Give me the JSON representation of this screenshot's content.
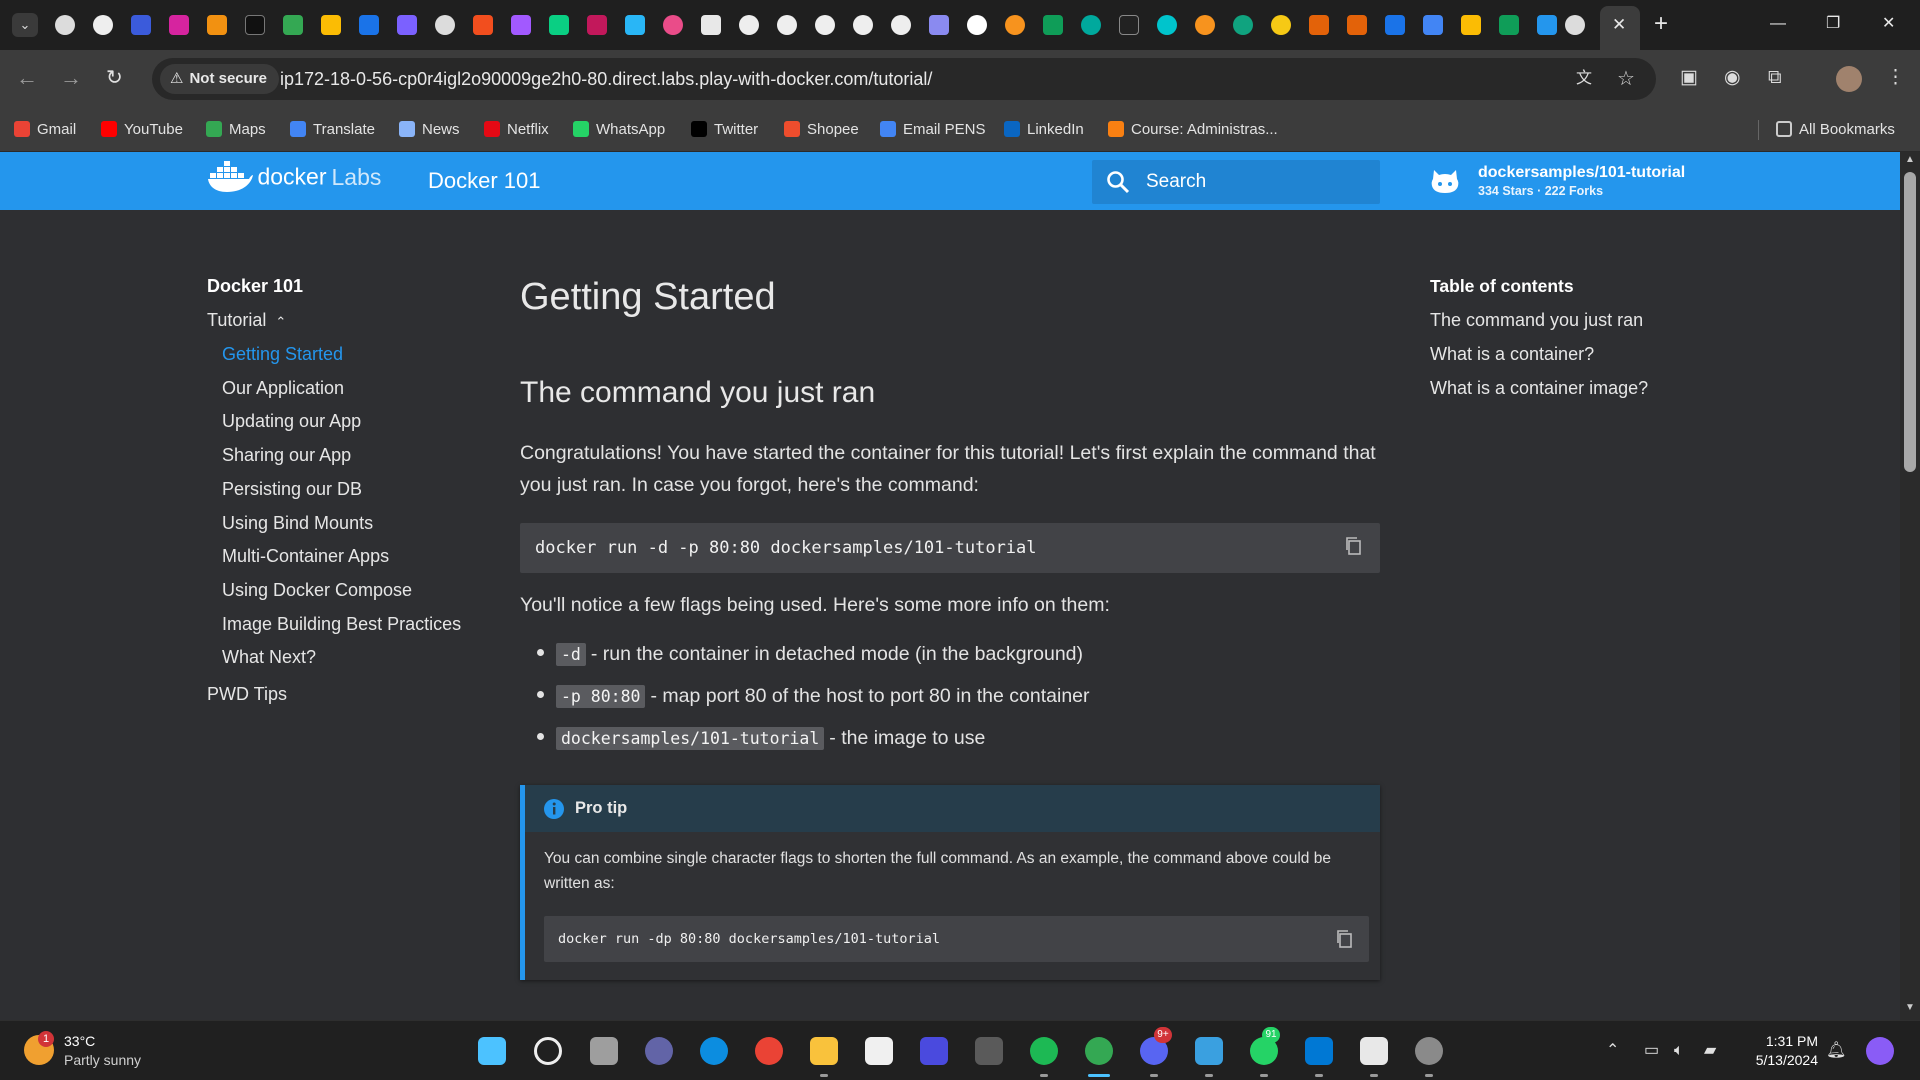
{
  "browser": {
    "tab_close": "✕",
    "new_tab": "+",
    "address": {
      "security_label": "Not secure",
      "url": "ip172-18-0-56-cp0r4igl2o90009ge2h0-80.direct.labs.play-with-docker.com/tutorial/"
    },
    "bookmarks": [
      {
        "label": "Gmail",
        "icon": "gmail-icon",
        "color": "#ea4335"
      },
      {
        "label": "YouTube",
        "icon": "youtube-icon",
        "color": "#ff0000"
      },
      {
        "label": "Maps",
        "icon": "maps-icon",
        "color": "#34a853"
      },
      {
        "label": "Translate",
        "icon": "translate-icon",
        "color": "#4285f4"
      },
      {
        "label": "News",
        "icon": "news-icon",
        "color": "#8ab4f8"
      },
      {
        "label": "Netflix",
        "icon": "netflix-icon",
        "color": "#e50914"
      },
      {
        "label": "WhatsApp",
        "icon": "whatsapp-icon",
        "color": "#25d366"
      },
      {
        "label": "Twitter",
        "icon": "x-icon",
        "color": "#000000"
      },
      {
        "label": "Shopee",
        "icon": "shopee-icon",
        "color": "#ee4d2d"
      },
      {
        "label": "Email PENS",
        "icon": "email-icon",
        "color": "#4285f4"
      },
      {
        "label": "LinkedIn",
        "icon": "linkedin-icon",
        "color": "#0a66c2"
      },
      {
        "label": "Course: Administras...",
        "icon": "moodle-icon",
        "color": "#f98012"
      }
    ],
    "all_bookmarks": "All Bookmarks"
  },
  "site": {
    "logo_text": "docker",
    "logo_suffix": "Labs",
    "title": "Docker 101",
    "search_placeholder": "Search",
    "repo_name": "dockersamples/101-tutorial",
    "repo_facts": "334 Stars · 222 Forks"
  },
  "sidebar": {
    "title": "Docker 101",
    "section": "Tutorial",
    "items": [
      "Getting Started",
      "Our Application",
      "Updating our App",
      "Sharing our App",
      "Persisting our DB",
      "Using Bind Mounts",
      "Multi-Container Apps",
      "Using Docker Compose",
      "Image Building Best Practices",
      "What Next?"
    ],
    "extra": "PWD Tips"
  },
  "content": {
    "title": "Getting Started",
    "subtitle": "The command you just ran",
    "intro": "Congratulations! You have started the container for this tutorial! Let's first explain the command that you just ran. In case you forgot, here's the command:",
    "command": "docker run -d -p 80:80 dockersamples/101-tutorial",
    "flags_intro": "You'll notice a few flags being used. Here's some more info on them:",
    "flags": [
      {
        "code": "-d",
        "desc": "- run the container in detached mode (in the background)"
      },
      {
        "code": "-p 80:80",
        "desc": "- map port 80 of the host to port 80 in the container"
      },
      {
        "code": "dockersamples/101-tutorial",
        "desc": "- the image to use"
      }
    ],
    "tip": {
      "title": "Pro tip",
      "text": "You can combine single character flags to shorten the full command. As an example, the command above could be written as:",
      "command": "docker run -dp 80:80 dockersamples/101-tutorial"
    }
  },
  "toc": {
    "title": "Table of contents",
    "items": [
      "The command you just ran",
      "What is a container?",
      "What is a container image?"
    ]
  },
  "taskbar": {
    "weather_temp": "33°C",
    "weather_desc": "Partly sunny",
    "weather_badge": "1",
    "discord_badge": "9+",
    "whatsapp_badge": "91",
    "time": "1:31 PM",
    "date": "5/13/2024"
  },
  "colors": {
    "accent": "#2496ed",
    "page_bg": "#2e2f32",
    "code_bg": "#424347"
  }
}
